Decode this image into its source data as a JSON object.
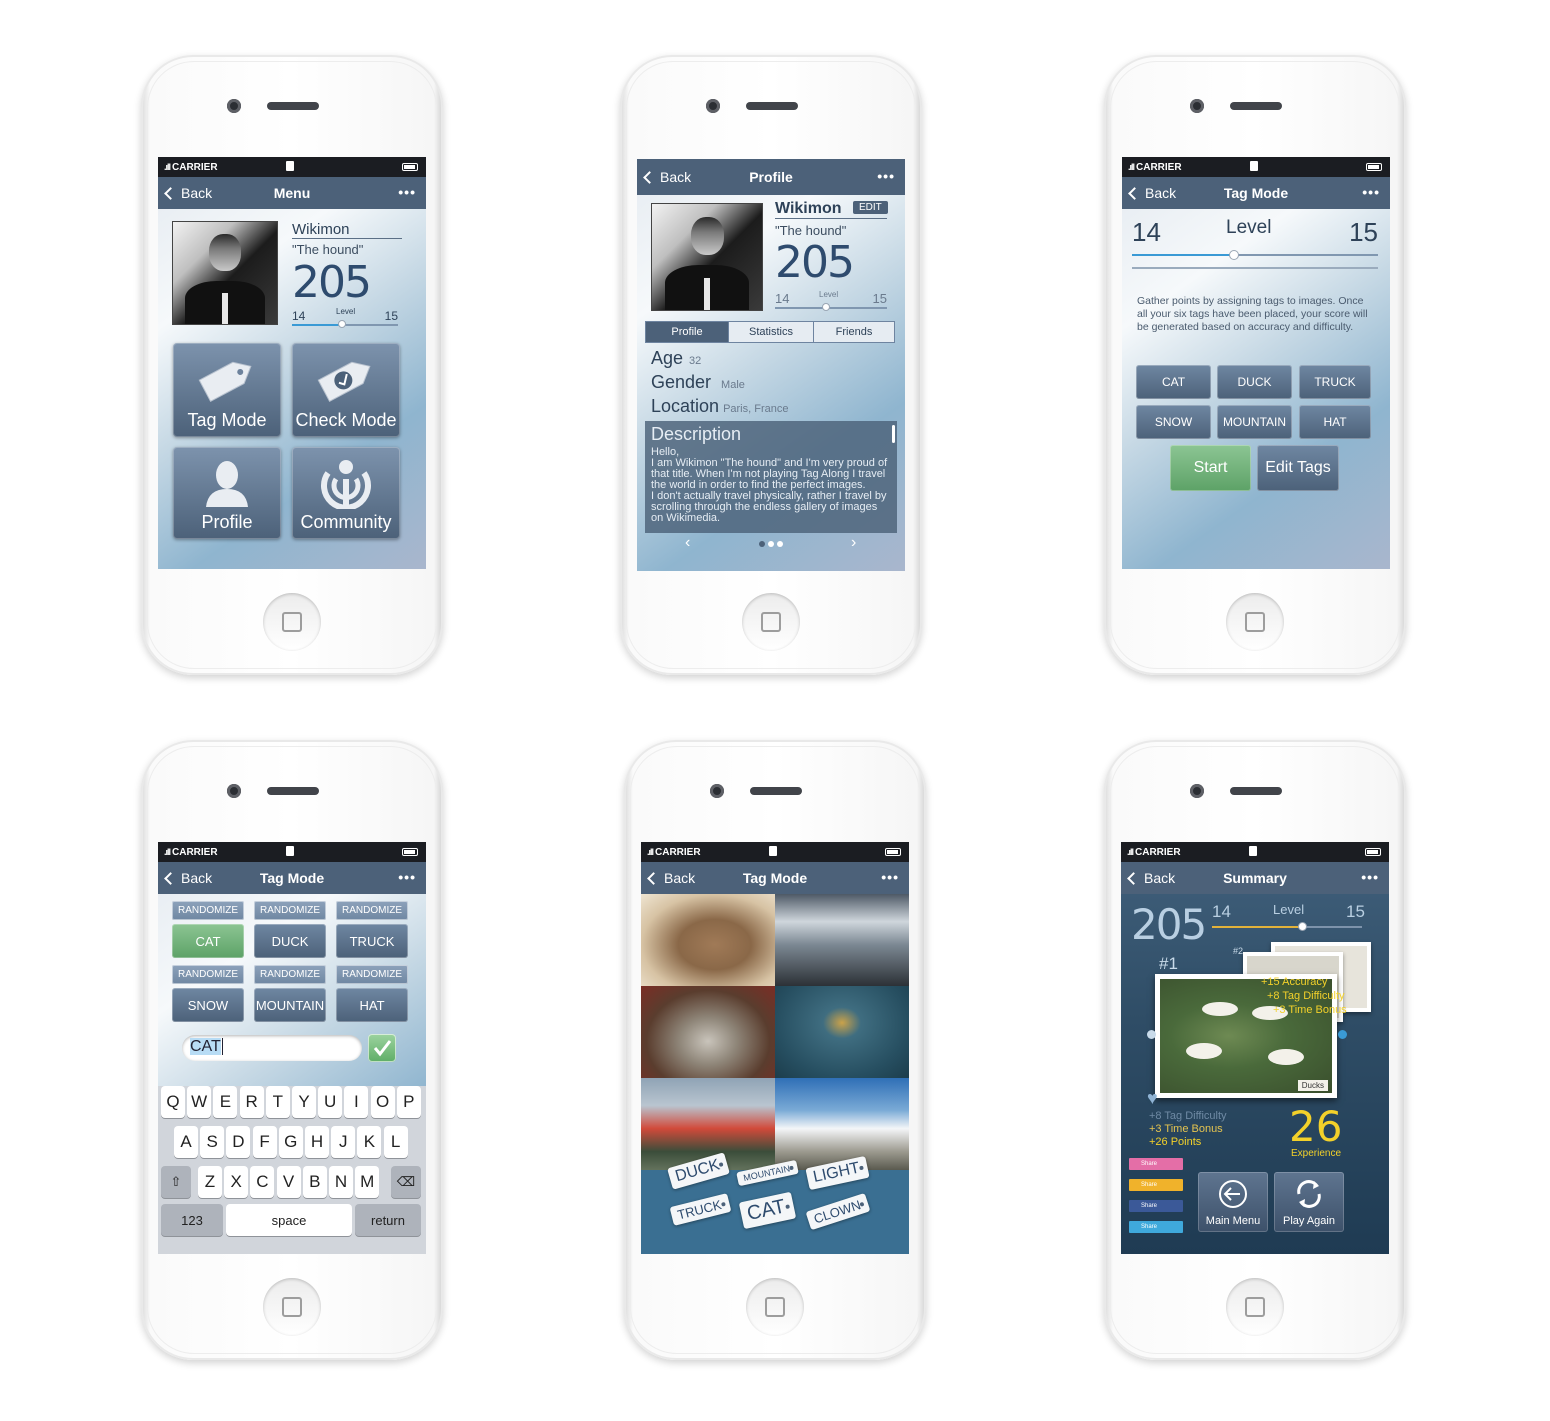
{
  "status": {
    "carrier": "CARRIER"
  },
  "nav_common": {
    "back": "Back",
    "more": "•••"
  },
  "screen1": {
    "title": "Menu",
    "user": "Wikimon",
    "nick": "\"The hound\"",
    "score": "205",
    "level_label": "Level",
    "level_from": "14",
    "level_to": "15",
    "level_progress": 0.45,
    "tiles": [
      "Tag Mode",
      "Check Mode",
      "Profile",
      "Community"
    ]
  },
  "screen2": {
    "title": "Profile",
    "user": "Wikimon",
    "edit": "EDIT",
    "nick": "\"The hound\"",
    "score": "205",
    "level_label": "Level",
    "level_from": "14",
    "level_to": "15",
    "tabs": [
      "Profile",
      "Statistics",
      "Friends"
    ],
    "age_label": "Age",
    "age": "32",
    "gender_label": "Gender",
    "gender": "Male",
    "location_label": "Location",
    "location": "Paris, France",
    "desc_title": "Description",
    "desc": "Hello,\nI am Wikimon \"The hound\" and I'm very proud of that title. When I'm not playing Tag Along I travel the world in order to find the perfect images.\nI don't actually travel physically, rather I travel by scrolling through the endless gallery of images on Wikimedia."
  },
  "screen3": {
    "title": "Tag Mode",
    "level_from": "14",
    "level_label": "Level",
    "level_to": "15",
    "level_progress": 0.42,
    "instructions": "Gather points by assigning tags to images. Once all your six tags have been placed, your score will be generated based on accuracy and difficulty.",
    "tags": [
      "CAT",
      "DUCK",
      "TRUCK",
      "SNOW",
      "MOUNTAIN",
      "HAT"
    ],
    "start": "Start",
    "edit_tags": "Edit Tags"
  },
  "screen4": {
    "title": "Tag Mode",
    "randomize": "RANDOMIZE",
    "tags": [
      "CAT",
      "DUCK",
      "TRUCK",
      "SNOW",
      "MOUNTAIN",
      "HAT"
    ],
    "input_value": "CAT",
    "keys_row1": [
      "Q",
      "W",
      "E",
      "R",
      "T",
      "Y",
      "U",
      "I",
      "O",
      "P"
    ],
    "keys_row2": [
      "A",
      "S",
      "D",
      "F",
      "G",
      "H",
      "J",
      "K",
      "L"
    ],
    "keys_row3": [
      "Z",
      "X",
      "C",
      "V",
      "B",
      "N",
      "M"
    ],
    "key_123": "123",
    "key_space": "space",
    "key_return": "return"
  },
  "screen5": {
    "title": "Tag Mode",
    "tag_pills": [
      "DUCK",
      "MOUNTAIN",
      "LIGHT",
      "TRUCK",
      "CAT",
      "CLOWN"
    ]
  },
  "screen6": {
    "title": "Summary",
    "score": "205",
    "level_from": "14",
    "level_label": "Level",
    "level_to": "15",
    "rank1": "#1",
    "rank2": "#2",
    "bonus_accuracy": "+15 Accuracy",
    "bonus_difficulty": "+8 Tag Difficulty",
    "bonus_time": "+3 Time Bonus",
    "card_caption": "Ducks",
    "line_difficulty": "+8 Tag Difficulty",
    "line_time": "+3 Time Bonus",
    "line_points": "+26 Points",
    "experience_value": "26",
    "experience_label": "Experience",
    "share": "Share",
    "main_menu": "Main Menu",
    "play_again": "Play Again"
  },
  "colors": {
    "nav": "#4c6179",
    "accent_blue": "#3a9ad5",
    "start_green": "#6ab074",
    "exp_yellow": "#f3d12a"
  }
}
